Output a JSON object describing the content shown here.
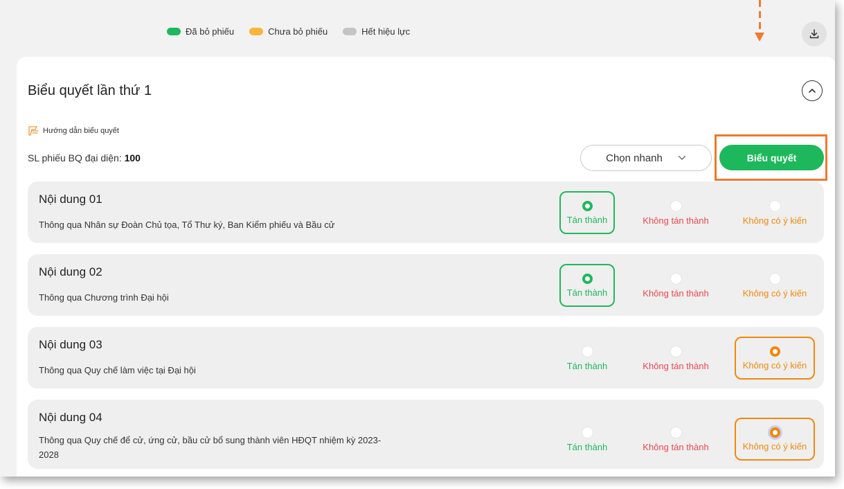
{
  "legend": [
    {
      "label": "Đã bỏ phiếu",
      "color": "#1eb85c"
    },
    {
      "label": "Chưa bỏ phiếu",
      "color": "#f9b53a"
    },
    {
      "label": "Hết hiệu lực",
      "color": "#c4c4c4"
    }
  ],
  "icons": {
    "download": "download-icon",
    "collapse": "chevron-up-icon",
    "guide": "guide-icon",
    "dropdown": "chevron-down-icon"
  },
  "card": {
    "title": "Biểu quyết lần thứ 1",
    "guide_label": "Hướng dẫn biểu quyết",
    "summary_label": "SL phiếu BQ đại diện:",
    "summary_value": "100",
    "quick_select_label": "Chọn nhanh",
    "vote_button_label": "Biểu quyết"
  },
  "options": {
    "approve": "Tán thành",
    "disapprove": "Không tán thành",
    "no_opinion": "Không có ý kiến"
  },
  "items": [
    {
      "title": "Nội dung 01",
      "description": "Thông qua Nhân sự Đoàn Chủ tọa, Tổ Thư ký, Ban Kiểm phiếu và Bầu cử",
      "selected": "approve"
    },
    {
      "title": "Nội dung 02",
      "description": "Thông qua Chương trình Đại hội",
      "selected": "approve"
    },
    {
      "title": "Nội dung 03",
      "description": "Thông qua Quy chế làm việc tại Đại hội",
      "selected": "no_opinion"
    },
    {
      "title": "Nội dung 04",
      "description": "Thông qua Quy chế để cử, ứng cử, bầu cử bổ sung thành viên HĐQT nhiệm kỳ 2023-2028",
      "selected": "no_opinion"
    }
  ],
  "colors": {
    "accent_green": "#1eb85c",
    "disapprove_red": "#e9484f",
    "no_opinion_orange": "#f0880a",
    "annotation_orange": "#ec7a2f"
  }
}
